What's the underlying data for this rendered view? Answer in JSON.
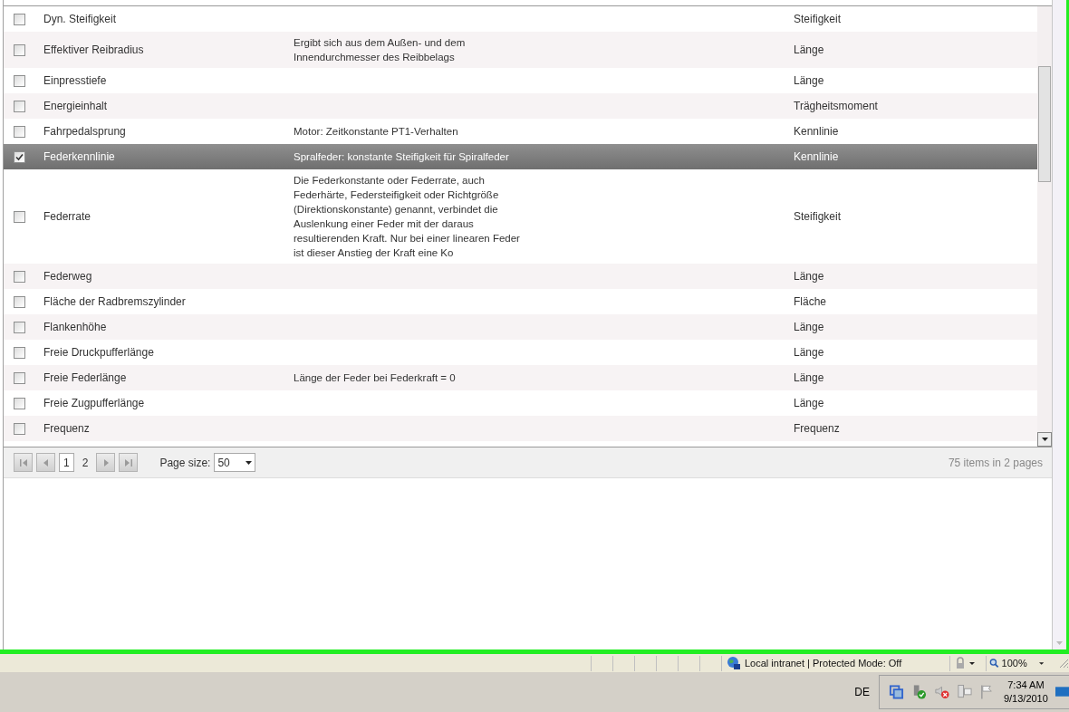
{
  "grid": {
    "rows": [
      {
        "name": "Dyn. Steifigkeit",
        "type": "Steifigkeit",
        "checked": false,
        "selected": false
      },
      {
        "name": "Effektiver Reibradius",
        "description": "Ergibt sich aus dem Außen- und dem Innendurchmesser des Reibbelags",
        "type": "Länge",
        "checked": false,
        "selected": false
      },
      {
        "name": "Einpresstiefe",
        "type": "Länge",
        "checked": false,
        "selected": false
      },
      {
        "name": "Energieinhalt",
        "type": "Trägheitsmoment",
        "checked": false,
        "selected": false
      },
      {
        "name": "Fahrpedalsprung",
        "description": "Motor: Zeitkonstante PT1-Verhalten",
        "type": "Kennlinie",
        "checked": false,
        "selected": false
      },
      {
        "name": "Federkennlinie",
        "description": "Spralfeder: konstante Steifigkeit für Spiralfeder",
        "type": "Kennlinie",
        "checked": true,
        "selected": true
      },
      {
        "name": "Federrate",
        "description": "Die Federkonstante oder Federrate, auch Federhärte, Federsteifigkeit oder Richtgröße (Direktionskonstante) genannt, verbindet die Auslenkung einer Feder mit der daraus resultierenden Kraft. Nur bei einer linearen Feder ist dieser Anstieg der Kraft eine Ko",
        "type": "Steifigkeit",
        "checked": false,
        "selected": false
      },
      {
        "name": "Federweg",
        "type": "Länge",
        "checked": false,
        "selected": false
      },
      {
        "name": "Fläche der Radbremszylinder",
        "type": "Fläche",
        "checked": false,
        "selected": false
      },
      {
        "name": "Flankenhöhe",
        "type": "Länge",
        "checked": false,
        "selected": false
      },
      {
        "name": "Freie Druckpufferlänge",
        "type": "Länge",
        "checked": false,
        "selected": false
      },
      {
        "name": "Freie Federlänge",
        "description": "Länge der Feder bei Federkraft = 0",
        "type": "Länge",
        "checked": false,
        "selected": false
      },
      {
        "name": "Freie Zugpufferlänge",
        "type": "Länge",
        "checked": false,
        "selected": false
      },
      {
        "name": "Frequenz",
        "type": "Frequenz",
        "checked": false,
        "selected": false
      }
    ]
  },
  "pager": {
    "pages": [
      {
        "label": "1",
        "selected": true
      },
      {
        "label": "2",
        "selected": false
      }
    ],
    "page_size_label": "Page size:",
    "page_size": "50",
    "summary": "75 items in 2 pages"
  },
  "status_bar": {
    "zone": "Local intranet | Protected Mode: Off",
    "zoom": "100%"
  },
  "taskbar": {
    "language": "DE",
    "time": "7:34 AM",
    "date": "9/13/2010"
  }
}
